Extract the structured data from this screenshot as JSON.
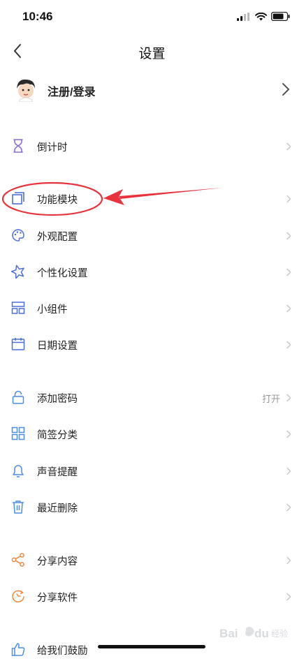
{
  "status_bar": {
    "time": "10:46"
  },
  "nav": {
    "title": "设置"
  },
  "profile": {
    "label": "注册/登录"
  },
  "rows": [
    {
      "label": "倒计时",
      "icon": "hourglass-icon",
      "color": "#8a6bd6"
    },
    {
      "label": "功能模块",
      "icon": "module-icon",
      "color": "#4a6fd8"
    },
    {
      "label": "外观配置",
      "icon": "palette-icon",
      "color": "#4a6fd8"
    },
    {
      "label": "个性化设置",
      "icon": "star-icon",
      "color": "#4a6fd8"
    },
    {
      "label": "小组件",
      "icon": "widget-icon",
      "color": "#4a6fd8"
    },
    {
      "label": "日期设置",
      "icon": "calendar-icon",
      "color": "#4a6fd8"
    },
    {
      "label": "添加密码",
      "value": "打开",
      "icon": "lock-icon",
      "color": "#4a8ee6"
    },
    {
      "label": "简签分类",
      "icon": "grid-icon",
      "color": "#4a8ee6"
    },
    {
      "label": "声音提醒",
      "icon": "bell-icon",
      "color": "#4a8ee6"
    },
    {
      "label": "最近删除",
      "icon": "trash-icon",
      "color": "#4a8ee6"
    },
    {
      "label": "分享内容",
      "icon": "share-icon",
      "color": "#f0883c"
    },
    {
      "label": "分享软件",
      "icon": "refresh-icon",
      "color": "#f0883c"
    },
    {
      "label": "给我们鼓励",
      "icon": "thumbs-up-icon",
      "color": "#4a8ee6"
    }
  ],
  "annotation_color": "#e8323c",
  "watermark": {
    "text": "Bai du 经验"
  }
}
